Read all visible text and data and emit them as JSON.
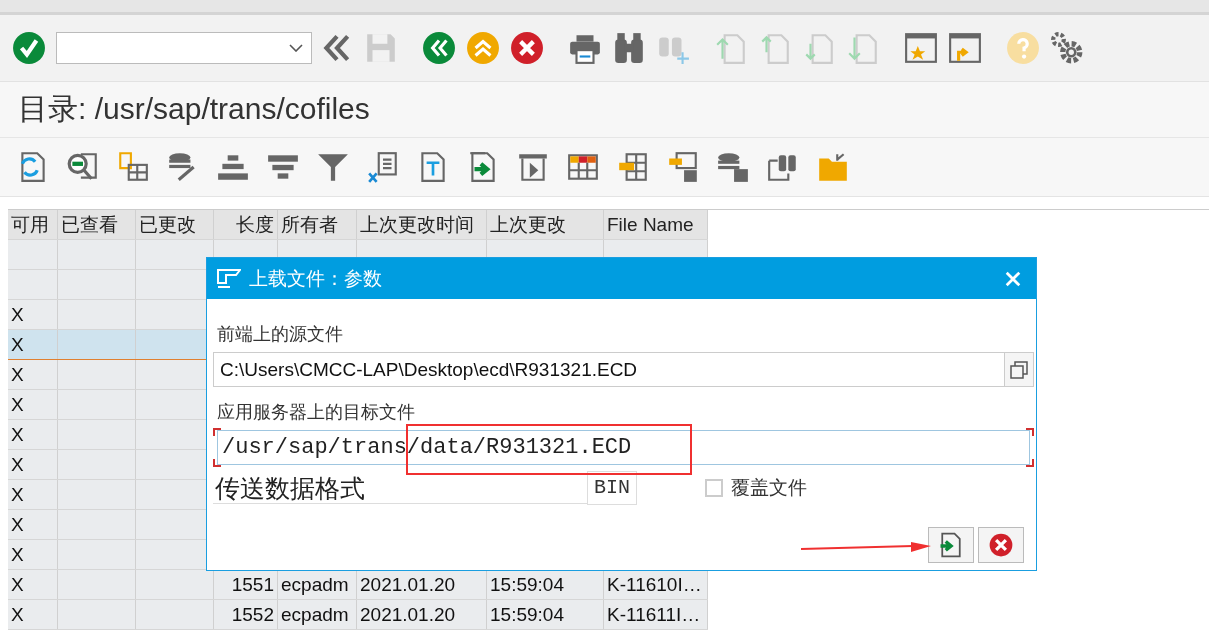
{
  "screen_title": "目录: /usr/sap/trans/cofiles",
  "table": {
    "columns": [
      "可用",
      "已查看",
      "已更改",
      "长度",
      "所有者",
      "上次更改时间",
      "上次更改",
      "File Name"
    ],
    "rows": [
      {
        "selected": false
      },
      {
        "selected": false
      },
      {
        "selected": false,
        "available": "X"
      },
      {
        "selected": true,
        "available": "X"
      },
      {
        "selected": false,
        "available": "X"
      },
      {
        "selected": false,
        "available": "X"
      },
      {
        "selected": false,
        "available": "X"
      },
      {
        "selected": false,
        "available": "X"
      },
      {
        "selected": false,
        "available": "X"
      },
      {
        "selected": false,
        "available": "X"
      },
      {
        "selected": false,
        "available": "X"
      },
      {
        "selected": false,
        "available": "X",
        "length": "1551",
        "owner": "ecpadm",
        "date": "2021.01.20",
        "time": "15:59:04",
        "file_name": "K-11610I…"
      },
      {
        "selected": false,
        "available": "X",
        "length": "1552",
        "owner": "ecpadm",
        "date": "2021.01.20",
        "time": "15:59:04",
        "file_name": "K-11611I…"
      }
    ]
  },
  "dialog": {
    "title": "上载文件：参数",
    "source_label": "前端上的源文件",
    "source_value": "C:\\Users\\CMCC-LAP\\Desktop\\ecd\\R931321.ECD",
    "target_label": "应用服务器上的目标文件",
    "target_value": "/usr/sap/trans/data/R931321.ECD",
    "format_label": "传送数据格式",
    "format_value": "BIN",
    "overwrite": {
      "label": "覆盖文件",
      "checked": false
    }
  }
}
